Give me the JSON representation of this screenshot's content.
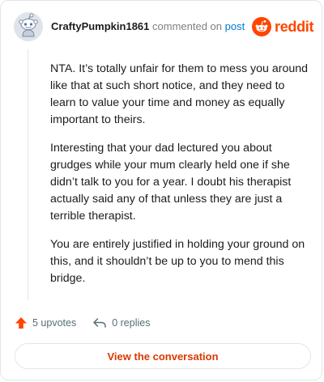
{
  "header": {
    "username": "CraftyPumpkin1861",
    "commented_text": "commented on",
    "post_link": "post",
    "logo_text": "reddit"
  },
  "comment": {
    "paragraphs": [
      "NTA. It’s totally unfair for them to mess you around like that at such short notice, and they need to learn to value your time and money as equally important to theirs.",
      "Interesting that your dad lectured you about grudges while your mum clearly held one if she didn’t talk to you for a year. I doubt his therapist actually said any of that unless they are just a terrible therapist.",
      "You are entirely justified in holding your ground on this, and it shouldn’t be up to you to mend this bridge."
    ]
  },
  "actions": {
    "upvotes": "5 upvotes",
    "replies": "0 replies",
    "upvote_icon": "arrow-up-icon",
    "reply_icon": "reply-arrow-icon"
  },
  "cta": {
    "label": "View the conversation"
  },
  "colors": {
    "brand": "#ff4500",
    "link": "#0079d3",
    "cta_text": "#d93900"
  }
}
